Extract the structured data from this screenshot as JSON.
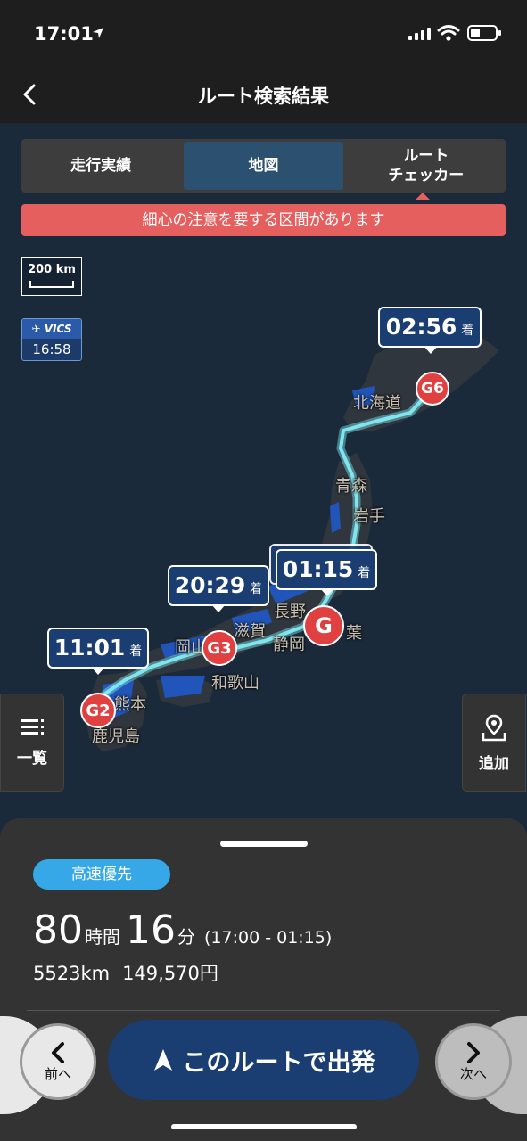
{
  "status_bar": {
    "time": "17:01"
  },
  "header": {
    "title": "ルート検索結果"
  },
  "tabs": [
    {
      "label": "走行実績"
    },
    {
      "label": "地図"
    },
    {
      "label_line1": "ルート",
      "label_line2": "チェッカー"
    }
  ],
  "alert": "細心の注意を要する区間があります",
  "map": {
    "scale_label": "200 km",
    "vics_brand": "VICS",
    "vics_time": "16:58",
    "arrivals": [
      {
        "time": "02:56",
        "suffix": "着",
        "goal": "G6"
      },
      {
        "time": "01:15",
        "suffix": "着",
        "goal": "G"
      },
      {
        "time": "20:29",
        "suffix": "着",
        "goal": "G3"
      },
      {
        "time": "11:01",
        "suffix": "着",
        "goal": "G2"
      }
    ],
    "places": [
      "北海道",
      "青森",
      "岩手",
      "長野",
      "静岡",
      "葉",
      "滋賀",
      "岡山",
      "和歌山",
      "熊本",
      "鹿児島"
    ],
    "list_button": "一覧",
    "add_button": "追加",
    "colors": {
      "route": "#7fe6f0",
      "goal": "#e04040",
      "bubble": "#1a3d72"
    }
  },
  "summary": {
    "preference": "高速優先",
    "hours": "80",
    "hours_unit": "時間",
    "minutes": "16",
    "minutes_unit": "分",
    "time_range": "(17:00 - 01:15)",
    "distance": "5523km",
    "cost": "149,570円"
  },
  "footer": {
    "prev_label": "前へ",
    "next_label": "次へ",
    "start_label": "このルートで出発"
  }
}
